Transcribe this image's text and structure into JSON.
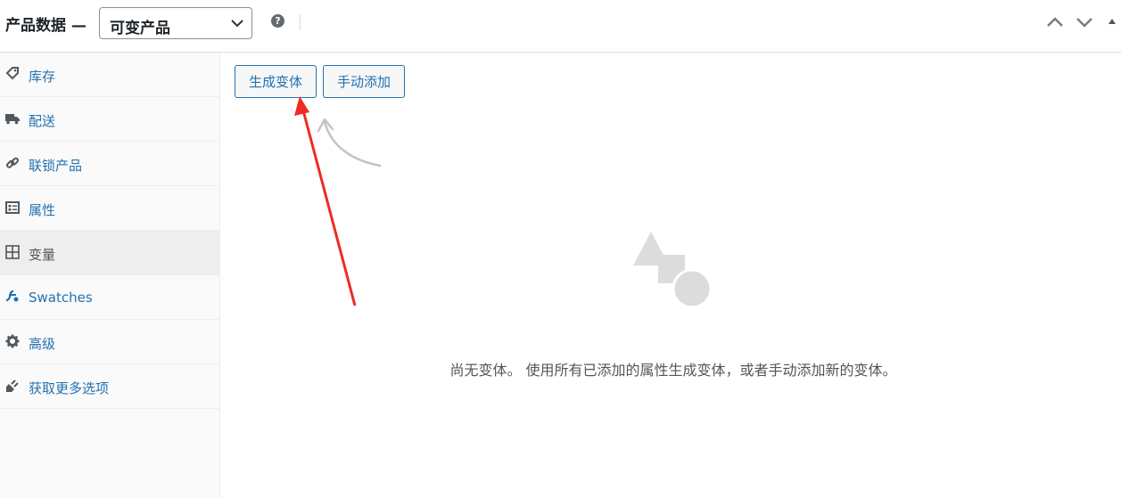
{
  "header": {
    "title": "产品数据 —",
    "product_type": "可变产品",
    "help_icon": "question-circle-icon",
    "help_glyph": "?"
  },
  "sidebar": {
    "items": [
      {
        "label": "库存",
        "icon": "tag-icon",
        "active": false
      },
      {
        "label": "配送",
        "icon": "truck-icon",
        "active": false
      },
      {
        "label": "联锁产品",
        "icon": "link-icon",
        "active": false
      },
      {
        "label": "属性",
        "icon": "list-card-icon",
        "active": false
      },
      {
        "label": "变量",
        "icon": "grid-icon",
        "active": true
      },
      {
        "label": "Swatches",
        "icon": "swatches-icon",
        "active": false
      },
      {
        "label": "高级",
        "icon": "gear-icon",
        "active": false
      },
      {
        "label": "获取更多选项",
        "icon": "plugin-icon",
        "active": false
      }
    ]
  },
  "main": {
    "generate_button": "生成变体",
    "manual_add_button": "手动添加",
    "empty_message": "尚无变体。 使用所有已添加的属性生成变体，或者手动添加新的变体。",
    "empty_icon": "shapes-icon"
  },
  "colors": {
    "link": "#2271b1",
    "annotation_arrow": "#ee2b24",
    "empty_icon": "#dcdcde"
  }
}
